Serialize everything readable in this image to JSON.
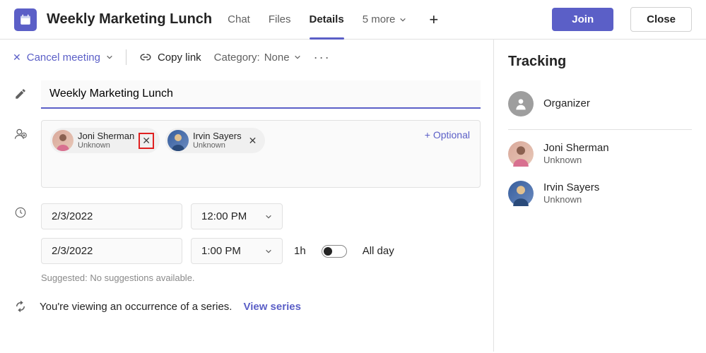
{
  "header": {
    "title": "Weekly Marketing Lunch",
    "tabs": {
      "chat": "Chat",
      "files": "Files",
      "details": "Details",
      "more": "5 more"
    },
    "join": "Join",
    "close": "Close"
  },
  "toolbar": {
    "cancel": "Cancel meeting",
    "copylink": "Copy link",
    "category_label": "Category:",
    "category_value": "None"
  },
  "form": {
    "title_value": "Weekly Marketing Lunch",
    "attendees": [
      {
        "name": "Joni Sherman",
        "status": "Unknown",
        "avatar": "av-joni"
      },
      {
        "name": "Irvin Sayers",
        "status": "Unknown",
        "avatar": "av-irvin"
      }
    ],
    "optional": "+ Optional",
    "start_date": "2/3/2022",
    "start_time": "12:00 PM",
    "end_date": "2/3/2022",
    "end_time": "1:00 PM",
    "duration": "1h",
    "allday": "All day",
    "suggested": "Suggested: No suggestions available.",
    "series_text": "You're viewing an occurrence of a series.",
    "series_link": "View series"
  },
  "tracking": {
    "title": "Tracking",
    "organizer": "Organizer",
    "people": [
      {
        "name": "Joni Sherman",
        "status": "Unknown",
        "avatar": "av-joni"
      },
      {
        "name": "Irvin Sayers",
        "status": "Unknown",
        "avatar": "av-irvin"
      }
    ]
  }
}
